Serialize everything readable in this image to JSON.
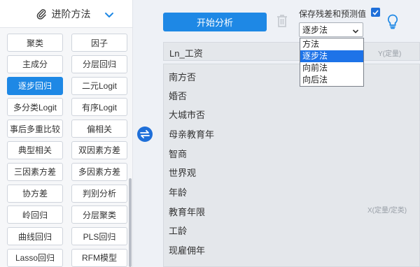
{
  "panel": {
    "title": "进阶方法",
    "methods": [
      {
        "label": "聚类",
        "active": false
      },
      {
        "label": "因子",
        "active": false
      },
      {
        "label": "主成分",
        "active": false
      },
      {
        "label": "分层回归",
        "active": false
      },
      {
        "label": "逐步回归",
        "active": true
      },
      {
        "label": "二元Logit",
        "active": false
      },
      {
        "label": "多分类Logit",
        "active": false
      },
      {
        "label": "有序Logit",
        "active": false
      },
      {
        "label": "事后多重比较",
        "active": false
      },
      {
        "label": "偏相关",
        "active": false
      },
      {
        "label": "典型相关",
        "active": false
      },
      {
        "label": "双因素方差",
        "active": false
      },
      {
        "label": "三因素方差",
        "active": false
      },
      {
        "label": "多因素方差",
        "active": false
      },
      {
        "label": "协方差",
        "active": false
      },
      {
        "label": "判别分析",
        "active": false
      },
      {
        "label": "岭回归",
        "active": false
      },
      {
        "label": "分层聚类",
        "active": false
      },
      {
        "label": "曲线回归",
        "active": false
      },
      {
        "label": "PLS回归",
        "active": false
      },
      {
        "label": "Lasso回归",
        "active": false
      },
      {
        "label": "RFM模型",
        "active": false
      }
    ]
  },
  "toolbar": {
    "start_label": "开始分析",
    "save_label": "保存残差和预测值",
    "save_checked": true
  },
  "method_select": {
    "value": "逐步法",
    "options": [
      "方法",
      "逐步法",
      "向前法",
      "向后法"
    ],
    "selected_index": 1
  },
  "y_box": {
    "variable": "Ln_工资",
    "hint": "Y(定量)"
  },
  "x_box": {
    "variables": [
      "南方否",
      "婚否",
      "大城市否",
      "母亲教育年",
      "智商",
      "世界观",
      "年龄",
      "教育年限",
      "工龄",
      "现雇佣年"
    ],
    "hint": "X(定量/定类)"
  },
  "colors": {
    "accent": "#1e88e5",
    "panel_bg": "#f6f7f9",
    "box_bg": "#e4e7eb"
  }
}
